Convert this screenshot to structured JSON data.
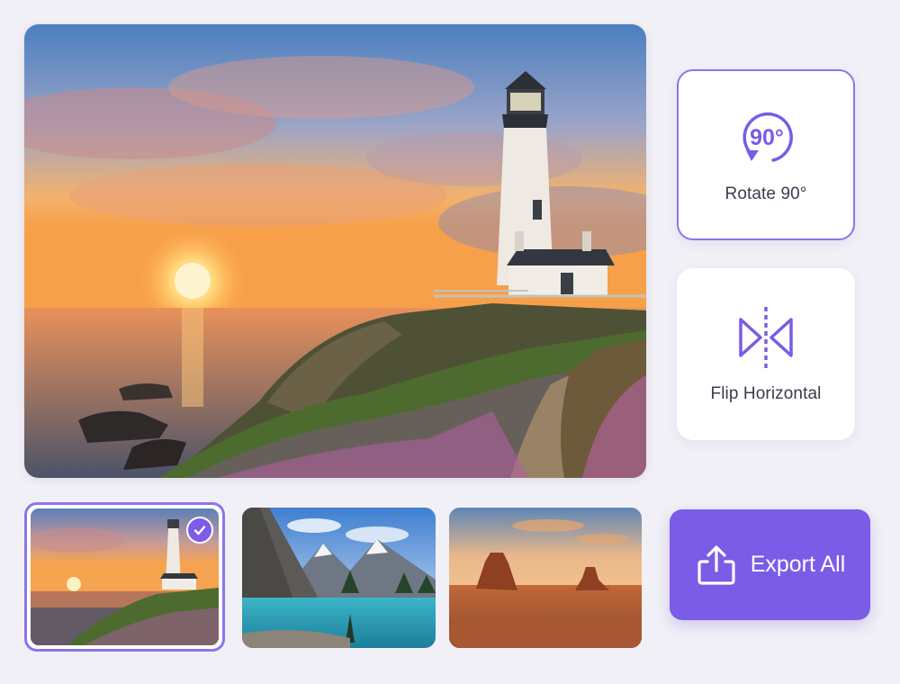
{
  "editor": {
    "preview_image": "lighthouse-sunset",
    "accent_color": "#7b5ce7",
    "border_color": "#8d74ea"
  },
  "tools": {
    "rotate": {
      "label": "Rotate 90°",
      "icon_text": "90°",
      "icon": "rotate-90-icon"
    },
    "flip": {
      "label": "Flip Horizontal",
      "icon": "flip-horizontal-icon"
    }
  },
  "thumbnails": [
    {
      "image": "lighthouse-sunset",
      "selected": true
    },
    {
      "image": "mountain-lake",
      "selected": false
    },
    {
      "image": "desert-buttes",
      "selected": false
    }
  ],
  "export": {
    "label": "Export All",
    "icon": "export-icon"
  }
}
